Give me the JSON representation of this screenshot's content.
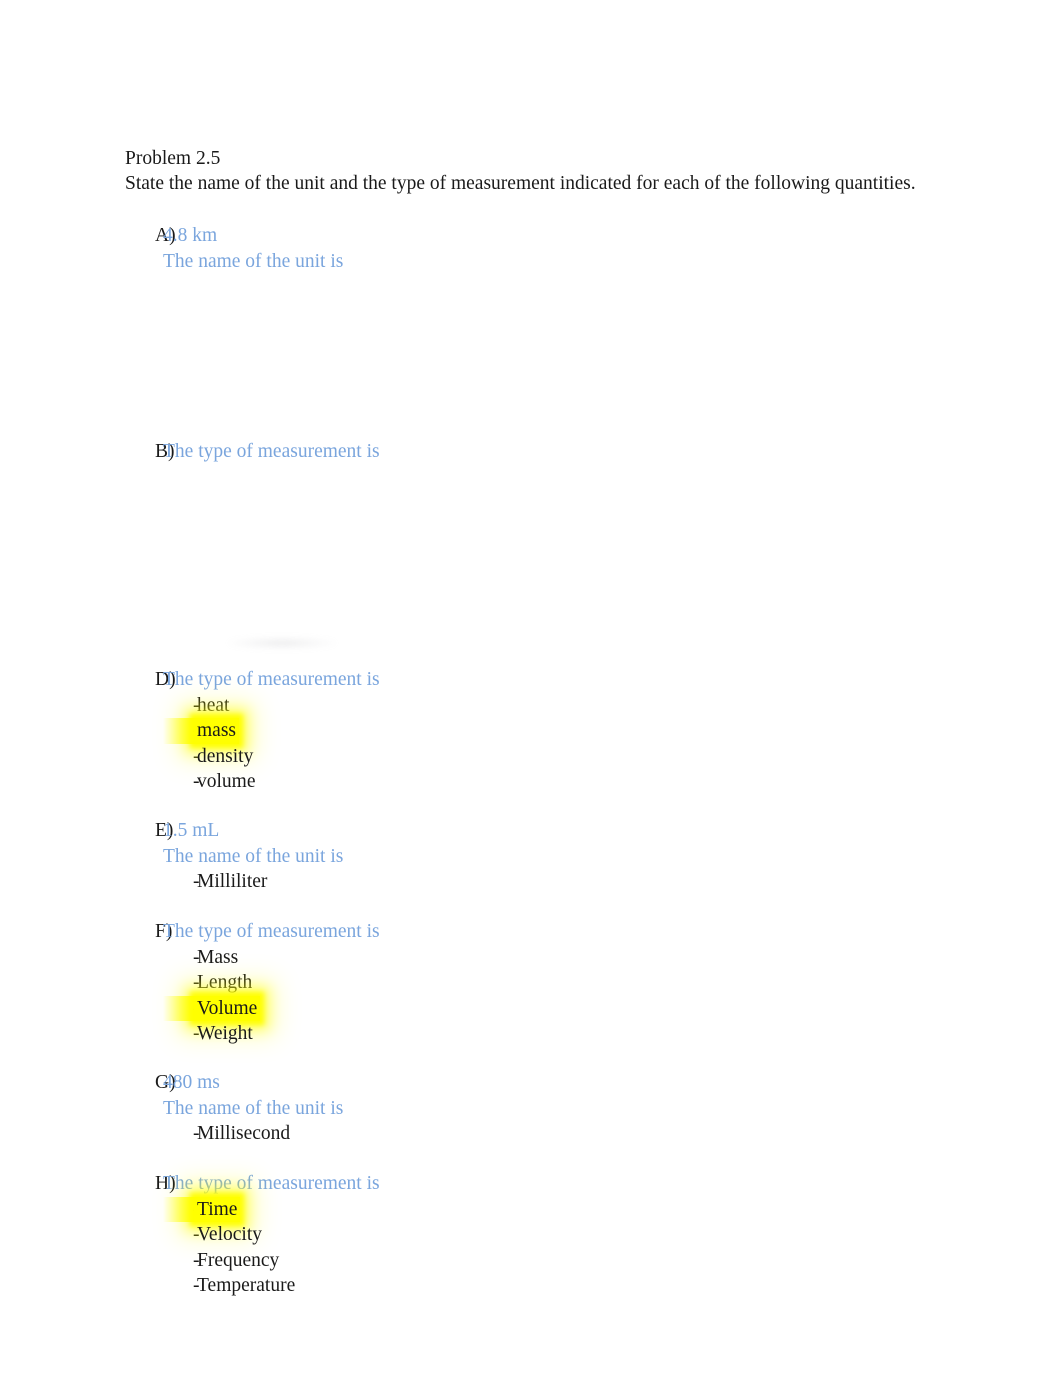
{
  "document": {
    "title": "Problem 2.5",
    "instruction": "State the name of the unit and the type of measurement indicated for each of the following quantities.",
    "prompt_color": "#7aa5dd",
    "highlight_color": "#ffff00",
    "text_color": "#1a1a1a"
  },
  "items": [
    {
      "letter": "A)",
      "quantity": "4.8 km",
      "prompt": "The name of the unit is",
      "choices": []
    },
    {
      "letter": "B)",
      "quantity": "",
      "prompt": "The type of measurement is",
      "choices": []
    },
    {
      "letter": "D)",
      "quantity": "",
      "prompt": "The type of measurement is",
      "choices": [
        {
          "label": "heat",
          "highlighted": false
        },
        {
          "label": "mass",
          "highlighted": true
        },
        {
          "label": "density",
          "highlighted": false
        },
        {
          "label": "volume",
          "highlighted": false
        }
      ]
    },
    {
      "letter": "E)",
      "quantity": "1.5 mL",
      "prompt": "The name of the unit is",
      "choices": [
        {
          "label": "Milliliter",
          "highlighted": false
        }
      ]
    },
    {
      "letter": "F)",
      "quantity": "",
      "prompt": "The type of measurement is",
      "choices": [
        {
          "label": "Mass",
          "highlighted": false
        },
        {
          "label": "Length",
          "highlighted": false
        },
        {
          "label": "Volume",
          "highlighted": true
        },
        {
          "label": "Weight",
          "highlighted": false
        }
      ]
    },
    {
      "letter": "G)",
      "quantity": "480 ms",
      "prompt": "The name of the unit is",
      "choices": [
        {
          "label": "Millisecond",
          "highlighted": false
        }
      ]
    },
    {
      "letter": "H)",
      "quantity": "",
      "prompt": "The type of measurement is",
      "choices": [
        {
          "label": "Time",
          "highlighted": true
        },
        {
          "label": "Velocity",
          "highlighted": false
        },
        {
          "label": "Frequency",
          "highlighted": false
        },
        {
          "label": "Temperature",
          "highlighted": false
        }
      ]
    }
  ],
  "layout": {
    "item_tops": [
      223,
      439,
      667,
      818,
      919,
      1070,
      1171
    ],
    "bullet_dash": "-"
  }
}
